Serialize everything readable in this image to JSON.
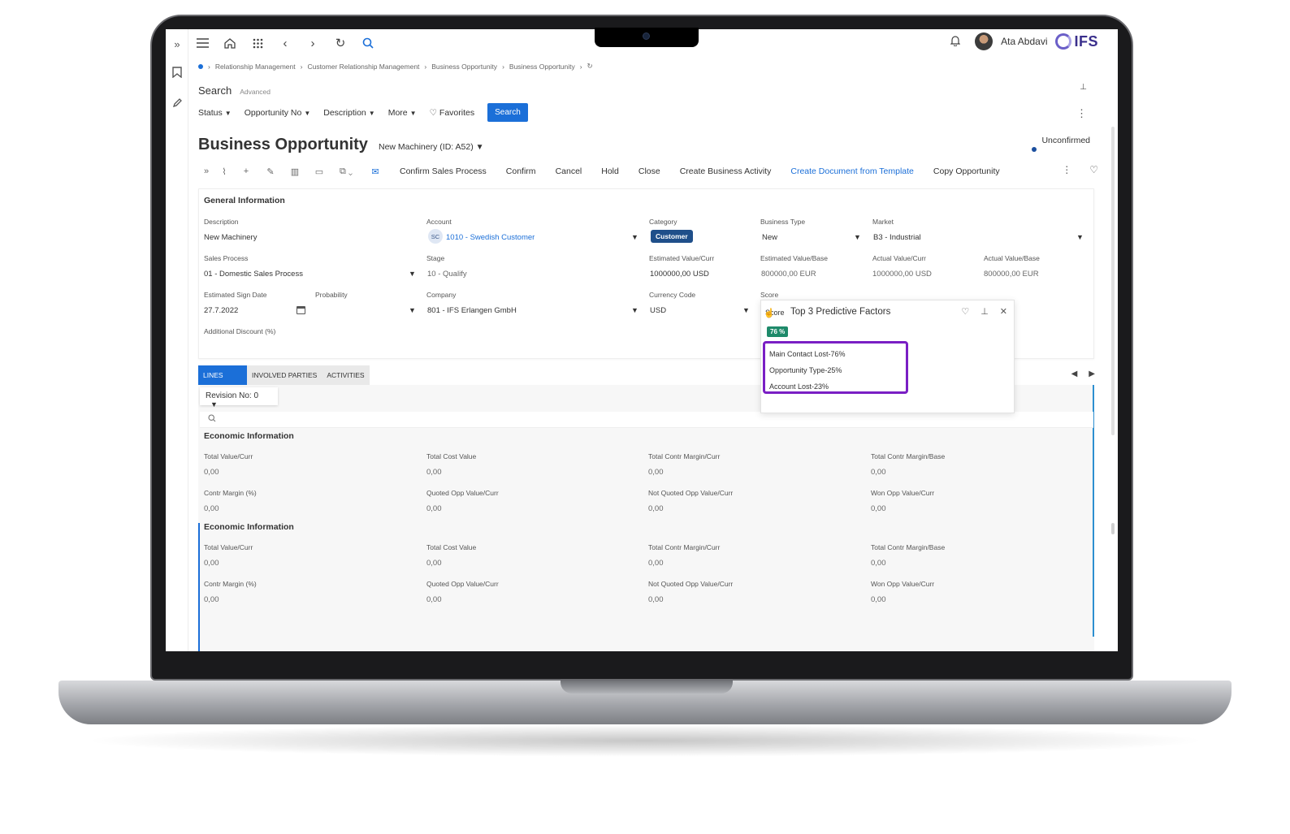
{
  "topnav": {
    "user_name": "Ata Abdavi",
    "logo_text": "IFS",
    "icons": [
      "menu-icon",
      "home-icon",
      "apps-grid-icon",
      "back-icon",
      "forward-icon",
      "refresh-icon",
      "search-icon",
      "bell-icon"
    ]
  },
  "breadcrumb": [
    "Relationship Management",
    "Customer Relationship Management",
    "Business Opportunity",
    "Business Opportunity"
  ],
  "search": {
    "title": "Search",
    "advanced": "Advanced",
    "filters": [
      "Status",
      "Opportunity No",
      "Description",
      "More"
    ],
    "favorites": "Favorites",
    "button": "Search"
  },
  "header": {
    "title": "Business Opportunity",
    "record": "New Machinery (ID: A52)",
    "status": "Unconfirmed"
  },
  "toolbar": {
    "buttons": [
      "Confirm Sales Process",
      "Confirm",
      "Cancel",
      "Hold",
      "Close",
      "Create Business Activity",
      "Create Document from Template",
      "Copy Opportunity"
    ]
  },
  "general": {
    "title": "General Information",
    "description_label": "Description",
    "description": "New Machinery",
    "account_label": "Account",
    "account_badge": "SC",
    "account": "1010 - Swedish Customer",
    "category_label": "Category",
    "category": "Customer",
    "business_type_label": "Business Type",
    "business_type": "New",
    "market_label": "Market",
    "market": "B3 - Industrial",
    "sales_process_label": "Sales Process",
    "sales_process": "01 - Domestic Sales Process",
    "stage_label": "Stage",
    "stage": "10 - Qualify",
    "est_value_curr_label": "Estimated Value/Curr",
    "est_value_curr": "1000000,00 USD",
    "est_value_base_label": "Estimated Value/Base",
    "est_value_base": "800000,00 EUR",
    "act_value_curr_label": "Actual Value/Curr",
    "act_value_curr": "1000000,00 USD",
    "act_value_base_label": "Actual Value/Base",
    "act_value_base": "800000,00 EUR",
    "sign_date_label": "Estimated Sign Date",
    "sign_date": "27.7.2022",
    "probability_label": "Probability",
    "company_label": "Company",
    "company": "801 - IFS Erlangen GmbH",
    "currency_label": "Currency Code",
    "currency": "USD",
    "score_label": "Score",
    "additional_discount_label": "Additional Discount (%)"
  },
  "popup": {
    "score_text": "Score",
    "title": "Top 3 Predictive Factors",
    "score_value": "76 %",
    "factors": [
      "Main Contact Lost-76%",
      "Opportunity Type-25%",
      "Account Lost-23%"
    ]
  },
  "tabs": [
    "LINES",
    "INVOLVED PARTIES",
    "ACTIVITIES"
  ],
  "revision": "Revision No: 0",
  "econ": [
    {
      "title": "Economic Information",
      "fields": [
        {
          "label": "Total Value/Curr",
          "value": "0,00"
        },
        {
          "label": "Total Cost Value",
          "value": "0,00"
        },
        {
          "label": "Total Contr Margin/Curr",
          "value": "0,00"
        },
        {
          "label": "Total Contr Margin/Base",
          "value": "0,00"
        },
        {
          "label": "Contr Margin (%)",
          "value": "0,00"
        },
        {
          "label": "Quoted Opp Value/Curr",
          "value": "0,00"
        },
        {
          "label": "Not Quoted Opp Value/Curr",
          "value": "0,00"
        },
        {
          "label": "Won Opp Value/Curr",
          "value": "0,00"
        }
      ]
    },
    {
      "title": "Economic Information",
      "fields": [
        {
          "label": "Total Value/Curr",
          "value": "0,00"
        },
        {
          "label": "Total Cost Value",
          "value": "0,00"
        },
        {
          "label": "Total Contr Margin/Curr",
          "value": "0,00"
        },
        {
          "label": "Total Contr Margin/Base",
          "value": "0,00"
        },
        {
          "label": "Contr Margin (%)",
          "value": "0,00"
        },
        {
          "label": "Quoted Opp Value/Curr",
          "value": "0,00"
        },
        {
          "label": "Not Quoted Opp Value/Curr",
          "value": "0,00"
        },
        {
          "label": "Won Opp Value/Curr",
          "value": "0,00"
        }
      ]
    }
  ],
  "colors": {
    "accent": "#1b6fd8",
    "category": "#1f4f8a",
    "score": "#1e8a6a",
    "highlight": "#7a1fc4"
  }
}
